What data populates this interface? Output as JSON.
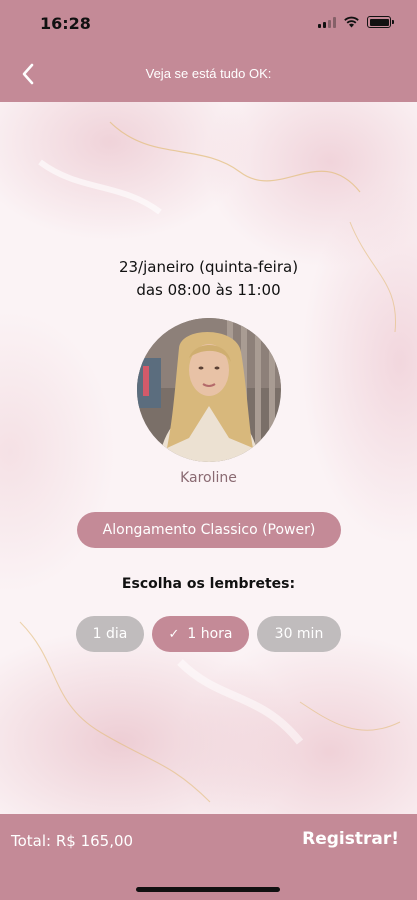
{
  "status_bar": {
    "time": "16:28",
    "icons": [
      "cellular-signal-icon",
      "wifi-icon",
      "battery-icon"
    ]
  },
  "nav": {
    "title": "Veja se está tudo OK:",
    "back_icon": "chevron-left-icon"
  },
  "appointment": {
    "date": "23/janeiro (quinta-feira)",
    "time_range": "das 08:00 às 11:00",
    "professional_name": "Karoline",
    "service": "Alongamento Classico (Power)"
  },
  "reminders": {
    "title": "Escolha os lembretes:",
    "options": [
      {
        "label": "1 dia",
        "selected": false
      },
      {
        "label": "1 hora",
        "selected": true
      },
      {
        "label": "30 min",
        "selected": false
      }
    ]
  },
  "footer": {
    "total": "Total: R$ 165,00",
    "register_label": "Registrar!"
  },
  "colors": {
    "primary": "#c48a97",
    "chip_inactive": "#c0bcbd",
    "name_text": "#8a6a72"
  }
}
